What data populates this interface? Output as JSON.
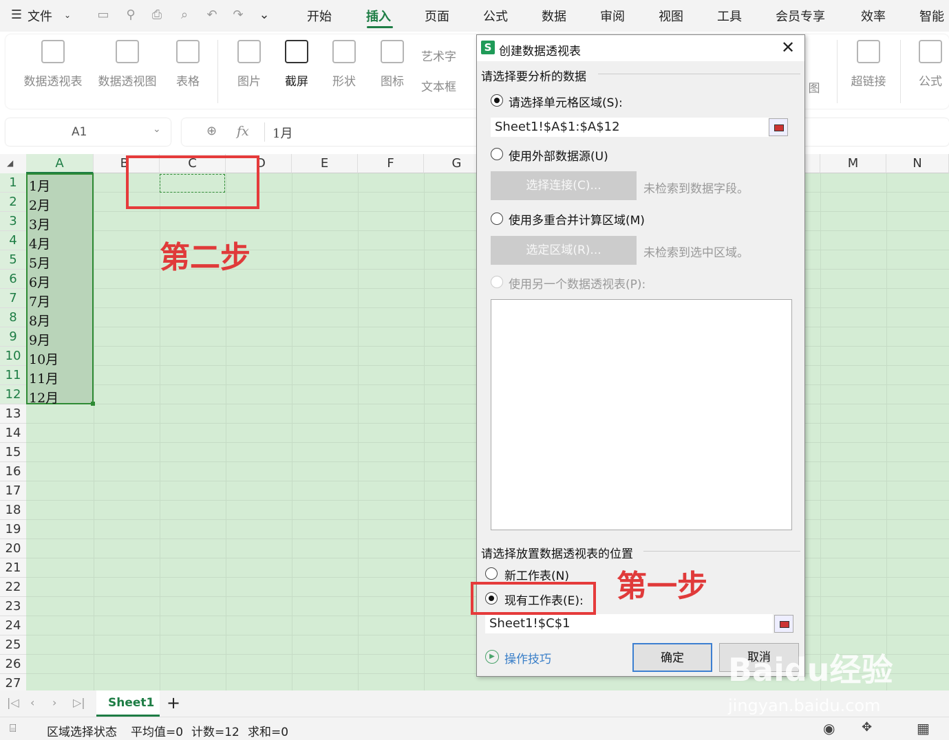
{
  "menubar": {
    "file_label": "文件",
    "tabs": [
      "开始",
      "插入",
      "页面",
      "公式",
      "数据",
      "审阅",
      "视图",
      "工具",
      "会员专享",
      "效率",
      "智能"
    ],
    "active_tab": "插入"
  },
  "ribbon": {
    "items": [
      "数据透视表",
      "数据透视图",
      "表格",
      "图片",
      "截屏",
      "形状",
      "图标",
      "艺术字",
      "文本框",
      "超链接",
      "公式"
    ],
    "partial_left": "图"
  },
  "formula": {
    "name_box": "A1",
    "fx_label": "fx",
    "content": "1月"
  },
  "grid": {
    "columns": [
      "A",
      "B",
      "C",
      "D",
      "E",
      "F",
      "G",
      "M",
      "N"
    ],
    "rows": [
      "1",
      "2",
      "3",
      "4",
      "5",
      "6",
      "7",
      "8",
      "9",
      "10",
      "11",
      "12",
      "13",
      "14",
      "15",
      "16",
      "17",
      "18",
      "19",
      "20",
      "21",
      "22",
      "23",
      "24",
      "25",
      "26",
      "27"
    ],
    "column_a_values": [
      "1月",
      "2月",
      "3月",
      "4月",
      "5月",
      "6月",
      "7月",
      "8月",
      "9月",
      "10月",
      "11月",
      "12月"
    ]
  },
  "annotations": {
    "step2": "第二步",
    "step1": "第一步"
  },
  "dialog": {
    "title": "创建数据透视表",
    "section1": "请选择要分析的数据",
    "opt_range": "请选择单元格区域(S):",
    "range_value": "Sheet1!$A$1:$A$12",
    "opt_external": "使用外部数据源(U)",
    "btn_connection": "选择连接(C)...",
    "connection_status": "未检索到数据字段。",
    "opt_multi": "使用多重合并计算区域(M)",
    "btn_select_area": "选定区域(R)...",
    "area_status": "未检索到选中区域。",
    "opt_other_pivot": "使用另一个数据透视表(P):",
    "section2": "请选择放置数据透视表的位置",
    "opt_new_sheet": "新工作表(N)",
    "opt_existing": "现有工作表(E):",
    "location_value": "Sheet1!$C$1",
    "tips": "操作技巧",
    "ok": "确定",
    "cancel": "取消"
  },
  "tabs": {
    "sheet": "Sheet1",
    "add": "+"
  },
  "status": {
    "mode": "区域选择状态",
    "average": "平均值=0",
    "count": "计数=12",
    "sum": "求和=0"
  },
  "watermark": {
    "brand": "Baidu经验",
    "url": "jingyan.baidu.com"
  }
}
